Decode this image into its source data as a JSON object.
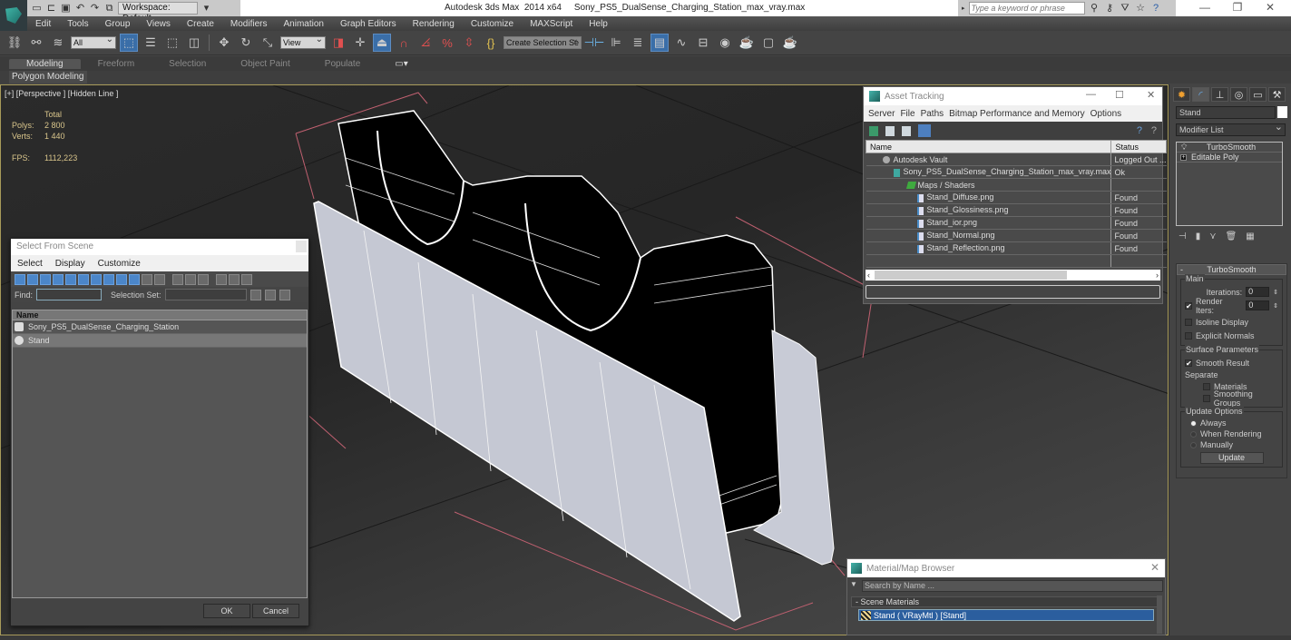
{
  "titlebar": {
    "workspace": "Workspace: Default",
    "title": "Autodesk 3ds Max  2014 x64     Sony_PS5_DualSense_Charging_Station_max_vray.max",
    "search_placeholder": "Type a keyword or phrase",
    "window_buttons": [
      "—",
      "❐",
      "✕"
    ]
  },
  "menubar": [
    "Edit",
    "Tools",
    "Group",
    "Views",
    "Create",
    "Modifiers",
    "Animation",
    "Graph Editors",
    "Rendering",
    "Customize",
    "MAXScript",
    "Help"
  ],
  "toolbar": {
    "selection_filter": "All",
    "reference_coord": "View",
    "named_selection_placeholder": "Create Selection Se"
  },
  "ribbon": {
    "tabs": [
      "Modeling",
      "Freeform",
      "Selection",
      "Object Paint",
      "Populate"
    ],
    "active_tab": "Modeling",
    "panel": "Polygon Modeling"
  },
  "viewport": {
    "label": "[+] [Perspective ] [Hidden Line ]",
    "stats": {
      "header": "Total",
      "polys_label": "Polys:",
      "polys": "2 800",
      "verts_label": "Verts:",
      "verts": "1 440",
      "fps_label": "FPS:",
      "fps": "1112,223"
    }
  },
  "select_from_scene": {
    "title": "Select From Scene",
    "menu": [
      "Select",
      "Display",
      "Customize"
    ],
    "find_label": "Find:",
    "find_value": "",
    "selection_set_label": "Selection Set:",
    "column_name": "Name",
    "rows": [
      {
        "name": "Sony_PS5_DualSense_Charging_Station",
        "selected": false
      },
      {
        "name": "Stand",
        "selected": true
      }
    ],
    "ok": "OK",
    "cancel": "Cancel"
  },
  "asset_tracking": {
    "title": "Asset Tracking",
    "menu": [
      "Server",
      "File",
      "Paths",
      "Bitmap Performance and Memory",
      "Options"
    ],
    "columns": [
      "Name",
      "Status"
    ],
    "rows": [
      {
        "name": "Autodesk Vault",
        "status": "Logged Out ...",
        "indent": 1,
        "icon": "vault-icon"
      },
      {
        "name": "Sony_PS5_DualSense_Charging_Station_max_vray.max",
        "status": "Ok",
        "indent": 2,
        "icon": "max-file-icon"
      },
      {
        "name": "Maps / Shaders",
        "status": "",
        "indent": 3,
        "icon": "maps-folder-icon"
      },
      {
        "name": "Stand_Diffuse.png",
        "status": "Found",
        "indent": 4,
        "icon": "image-file-icon"
      },
      {
        "name": "Stand_Glossiness.png",
        "status": "Found",
        "indent": 4,
        "icon": "image-file-icon"
      },
      {
        "name": "Stand_ior.png",
        "status": "Found",
        "indent": 4,
        "icon": "image-file-icon"
      },
      {
        "name": "Stand_Normal.png",
        "status": "Found",
        "indent": 4,
        "icon": "image-file-icon"
      },
      {
        "name": "Stand_Reflection.png",
        "status": "Found",
        "indent": 4,
        "icon": "image-file-icon"
      }
    ]
  },
  "command_panel": {
    "object_name": "Stand",
    "modifier_list": "Modifier List",
    "stack": [
      "TurboSmooth",
      "Editable Poly"
    ],
    "rollout_title": "TurboSmooth",
    "main_group": "Main",
    "iterations_label": "Iterations:",
    "iterations": "0",
    "render_iters_label": "Render Iters:",
    "render_iters": "0",
    "render_iters_checked": true,
    "isoline_label": "Isoline Display",
    "isoline_checked": false,
    "explicit_normals_label": "Explicit Normals",
    "explicit_normals_checked": false,
    "surface_group": "Surface Parameters",
    "smooth_result_label": "Smooth Result",
    "smooth_result_checked": true,
    "separate_label": "Separate",
    "materials_label": "Materials",
    "smoothing_groups_label": "Smoothing Groups",
    "update_group": "Update Options",
    "update_options": [
      "Always",
      "When Rendering",
      "Manually"
    ],
    "update_selected": "Always",
    "update_button": "Update"
  },
  "material_browser": {
    "title": "Material/Map Browser",
    "search_placeholder": "Search by Name ...",
    "section": "- Scene Materials",
    "material": "Stand  ( VRayMtl )  [Stand]"
  },
  "colors": {
    "accent_blue": "#3a6ea8",
    "viewport_border": "#a89b5a",
    "stats_text": "#d9c58b",
    "selected_material": "#2b5e9e"
  }
}
